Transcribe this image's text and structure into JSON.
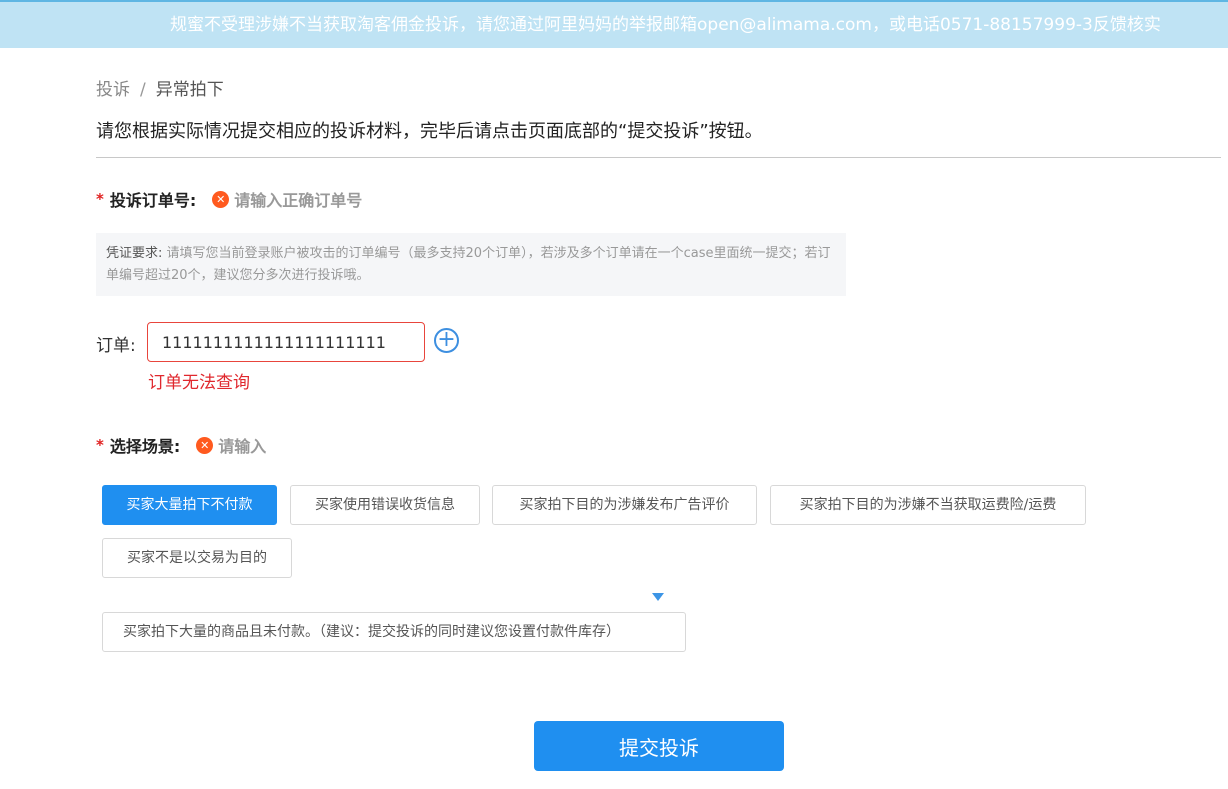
{
  "notice": {
    "text": "规蜜不受理涉嫌不当获取淘客佣金投诉，请您通过阿里妈妈的举报邮箱open@alimama.com，或电话0571-88157999-3反馈核实"
  },
  "breadcrumb": {
    "items": [
      "投诉",
      "异常拍下"
    ],
    "separator": "/"
  },
  "instruction": "请您根据实际情况提交相应的投诉材料，完毕后请点击页面底部的“提交投诉”按钮。",
  "order_section": {
    "required_mark": "*",
    "title": "投诉订单号:",
    "error_icon": "close-icon",
    "error": "请输入正确订单号",
    "requirement_label": "凭证要求:",
    "requirement_text": "请填写您当前登录账户被攻击的订单编号（最多支持20个订单），若涉及多个订单请在一个case里面统一提交；若订单编号超过20个，建议您分多次进行投诉哦。",
    "field_label": "订单:",
    "field_value": "1111111111111111111111",
    "add_icon": "plus-circle-icon",
    "add_symbol": "+",
    "field_error": "订单无法查询"
  },
  "scene_section": {
    "required_mark": "*",
    "title": "选择场景:",
    "error_icon": "close-icon",
    "error": "请输入",
    "options": [
      "买家大量拍下不付款",
      "买家使用错误收货信息",
      "买家拍下目的为涉嫌发布广告评价",
      "买家拍下目的为涉嫌不当获取运费险/运费",
      "买家不是以交易为目的"
    ],
    "selected_index": 0,
    "hint": "买家拍下大量的商品且未付款。（建议：提交投诉的同时建议您设置付款件库存）"
  },
  "submit_label": "提交投诉",
  "colors": {
    "primary": "#1f8ff0",
    "error": "#e0282e",
    "notice_bg": "#bfe3f4"
  }
}
